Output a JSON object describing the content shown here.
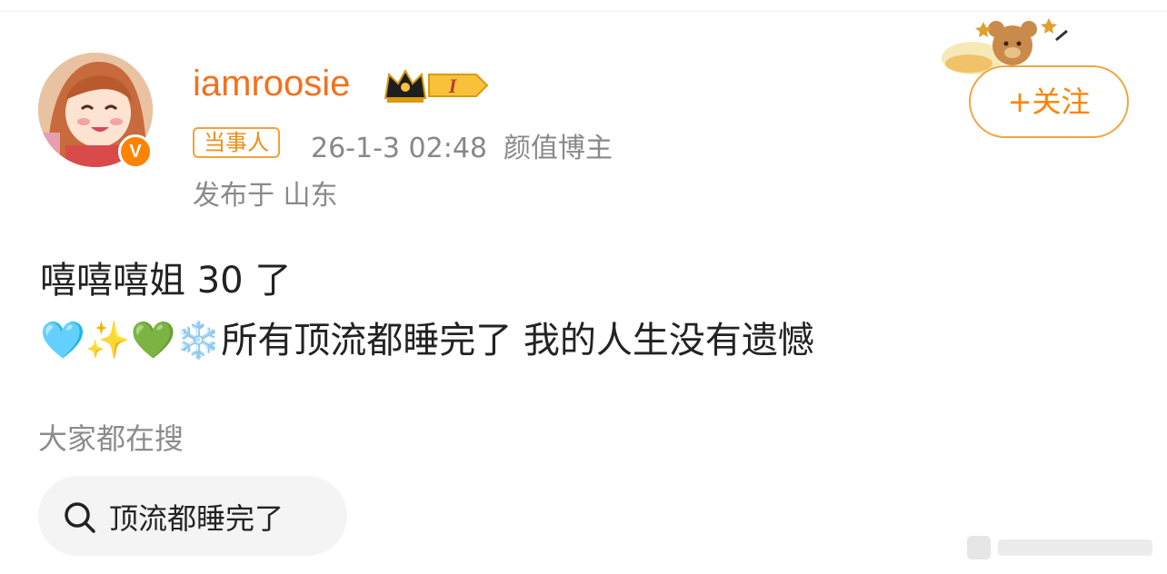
{
  "user": {
    "username": "iamroosie",
    "verified_mark": "V",
    "vip_level": "I",
    "role_badge": "当事人",
    "timestamp": "26-1-3 02:48",
    "category": "颜值博主",
    "location": "发布于 山东"
  },
  "follow": {
    "label": "+关注"
  },
  "post": {
    "line1": "嘻嘻嘻姐 30 了",
    "line2_emoji": "🩵✨💚❄️",
    "line2_text": "所有顶流都睡完了 我的人生没有遗憾"
  },
  "search": {
    "heading": "大家都在搜",
    "query": "顶流都睡完了"
  },
  "colors": {
    "brand_orange": "#ff8200",
    "username": "#f2711c",
    "meta_gray": "#888888",
    "pill_bg": "#f4f4f4"
  }
}
